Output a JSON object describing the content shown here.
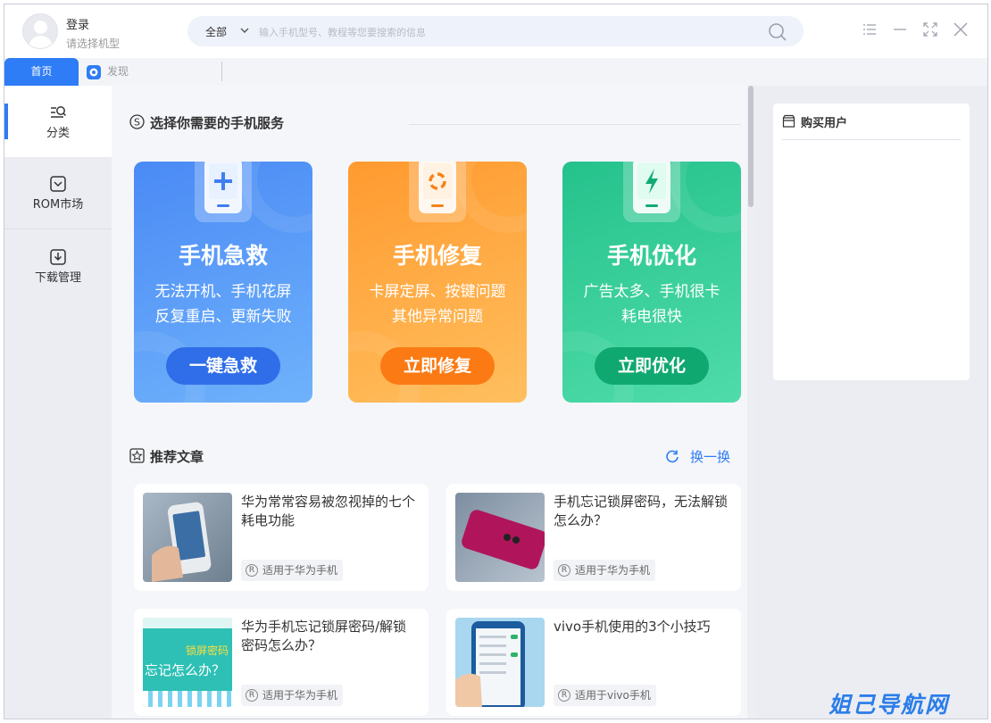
{
  "header": {
    "login_label": "登录",
    "login_sub": "请选择机型",
    "search_category": "全部",
    "search_placeholder": "输入手机型号、教程等您要搜索的信息"
  },
  "tabs": {
    "home": "首页",
    "discover": "发现"
  },
  "sidebar": {
    "items": [
      {
        "label": "分类",
        "icon": "category-search-icon",
        "active": true
      },
      {
        "label": "ROM市场",
        "icon": "rom-market-icon",
        "active": false
      },
      {
        "label": "下载管理",
        "icon": "download-icon",
        "active": false
      }
    ]
  },
  "services": {
    "title": "选择你需要的手机服务",
    "cards": [
      {
        "title": "手机急救",
        "desc1": "无法开机、手机花屏",
        "desc2": "反复重启、更新失败",
        "button": "一键急救",
        "icon": "plus-icon",
        "color": "#4a8af5"
      },
      {
        "title": "手机修复",
        "desc1": "卡屏定屏、按键问题",
        "desc2": "其他异常问题",
        "button": "立即修复",
        "icon": "repair-icon",
        "color": "#ff9a2f"
      },
      {
        "title": "手机优化",
        "desc1": "广告太多、手机很卡",
        "desc2": "耗电很快",
        "button": "立即优化",
        "icon": "lightning-icon",
        "color": "#25c28c"
      }
    ]
  },
  "articles": {
    "title": "推荐文章",
    "refresh_label": "换一换",
    "items": [
      {
        "title": "华为常常容易被忽视掉的七个耗电功能",
        "tag": "适用于华为手机"
      },
      {
        "title": "手机忘记锁屏密码，无法解锁怎么办？",
        "tag": "适用于华为手机"
      },
      {
        "title": "华为手机忘记锁屏密码/解锁密码怎么办？",
        "tag": "适用于华为手机",
        "thumb_text1": "锁屏密码",
        "thumb_text2": "忘记怎么办？"
      },
      {
        "title": "vivo手机使用的3个小技巧",
        "tag": "适用于vivo手机"
      }
    ]
  },
  "right_panel": {
    "buyers_title": "购买用户"
  },
  "watermark": "姐己导航网"
}
